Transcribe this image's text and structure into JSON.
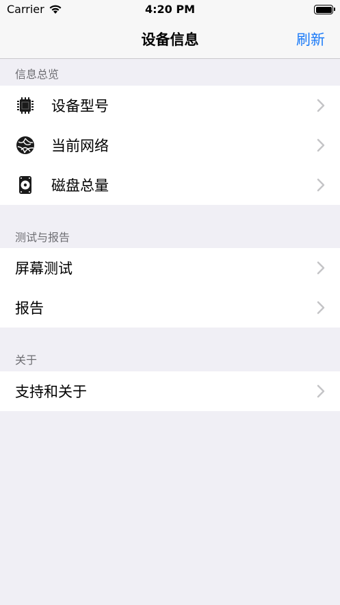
{
  "status_bar": {
    "carrier": "Carrier",
    "time": "4:20 PM"
  },
  "nav": {
    "title": "设备信息",
    "action": "刷新"
  },
  "sections": [
    {
      "header": "信息总览",
      "items": [
        {
          "label": "设备型号",
          "icon": "cpu-chip-icon"
        },
        {
          "label": "当前网络",
          "icon": "globe-network-icon"
        },
        {
          "label": "磁盘总量",
          "icon": "hard-disk-icon"
        }
      ]
    },
    {
      "header": "测试与报告",
      "items": [
        {
          "label": "屏幕测试"
        },
        {
          "label": "报告"
        }
      ]
    },
    {
      "header": "关于",
      "items": [
        {
          "label": "支持和关于"
        }
      ]
    }
  ]
}
